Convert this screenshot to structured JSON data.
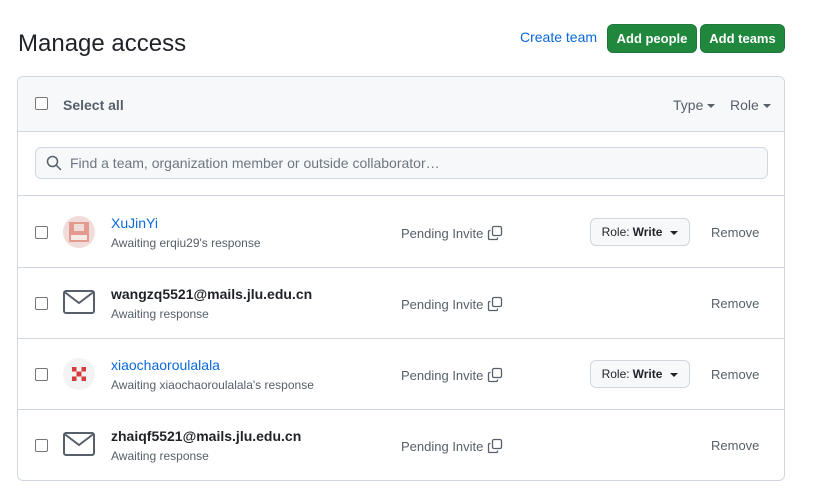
{
  "page": {
    "title": "Manage access",
    "create_team": "Create team",
    "add_people": "Add people",
    "add_teams": "Add teams"
  },
  "colors": {
    "primary_button": "#1f883d",
    "link": "#0969da",
    "muted_text": "#57606a",
    "border": "#d0d7de"
  },
  "toolbar": {
    "select_all": "Select all",
    "type_filter": "Type",
    "role_filter": "Role"
  },
  "search": {
    "placeholder": "Find a team, organization member or outside collaborator…"
  },
  "members": [
    {
      "name": "XuJinYi",
      "status": "Awaiting erqiu29's response",
      "invite": "Pending Invite",
      "role_prefix": "Role:",
      "role_value": "Write",
      "remove": "Remove",
      "avatar_icon": "identicon-pink"
    },
    {
      "name": "wangzq5521@mails.jlu.edu.cn",
      "status": "Awaiting response",
      "invite": "Pending Invite",
      "remove": "Remove",
      "avatar_icon": "mail-icon"
    },
    {
      "name": "xiaochaoroulalala",
      "status": "Awaiting xiaochaoroulalala's response",
      "invite": "Pending Invite",
      "role_prefix": "Role:",
      "role_value": "Write",
      "remove": "Remove",
      "avatar_icon": "identicon-red"
    },
    {
      "name": "zhaiqf5521@mails.jlu.edu.cn",
      "status": "Awaiting response",
      "invite": "Pending Invite",
      "remove": "Remove",
      "avatar_icon": "mail-icon"
    }
  ]
}
